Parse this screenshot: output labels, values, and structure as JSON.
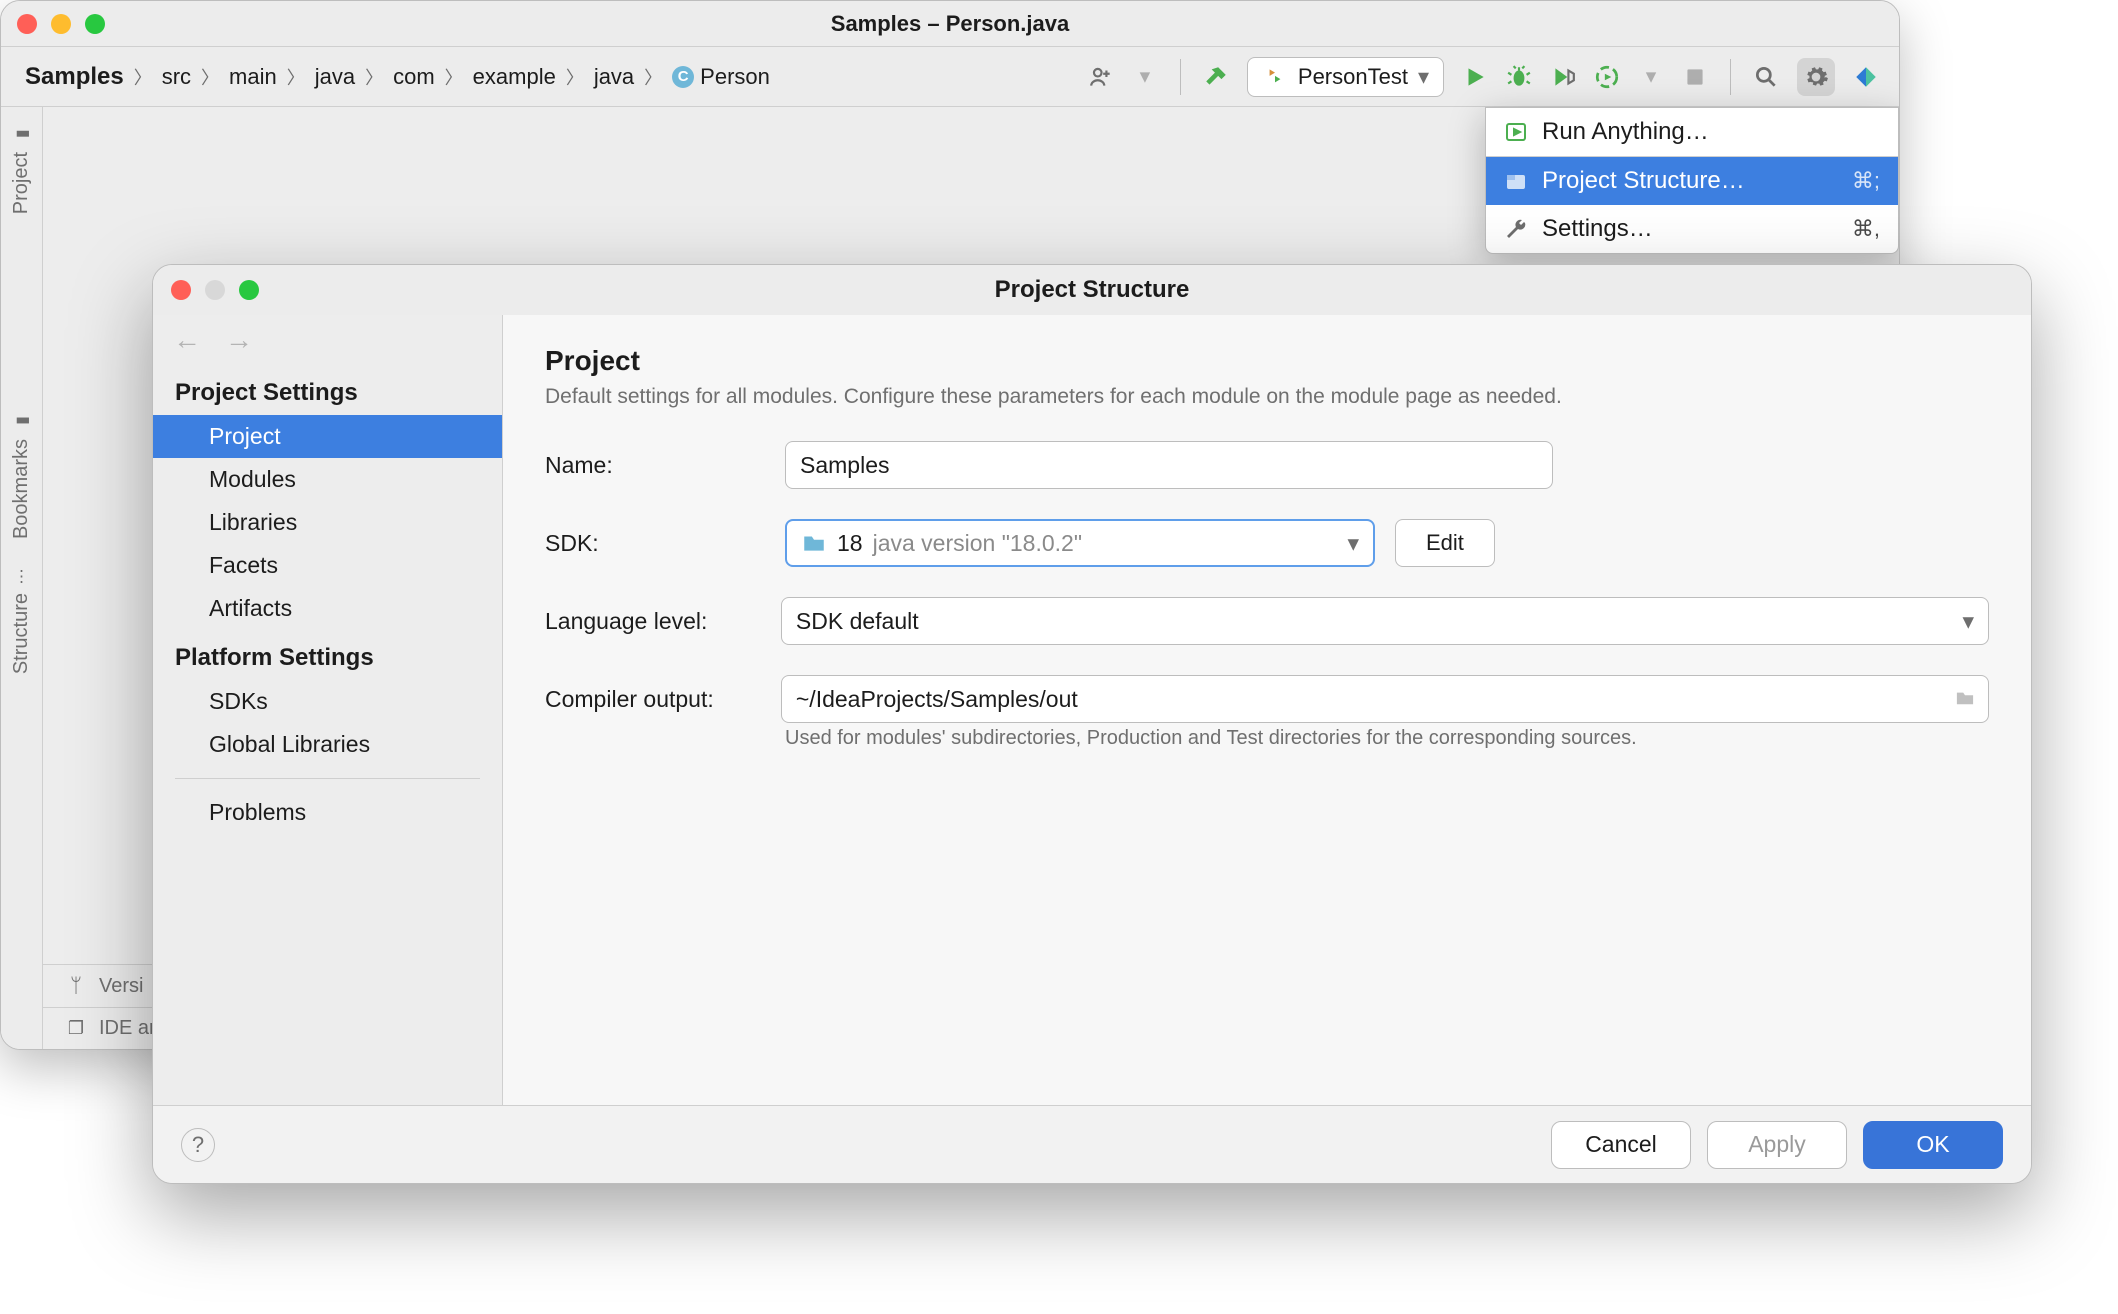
{
  "window": {
    "title": "Samples – Person.java"
  },
  "breadcrumbs": {
    "root": "Samples",
    "items": [
      "src",
      "main",
      "java",
      "com",
      "example",
      "java"
    ],
    "leaf": "Person",
    "leaf_icon": "C"
  },
  "toolbar": {
    "run_config_label": "PersonTest"
  },
  "left_tabs": {
    "project": "Project",
    "bookmarks": "Bookmarks",
    "structure": "Structure"
  },
  "statusbar": {
    "version": "Versi",
    "ide": "IDE ar"
  },
  "dropdown": {
    "run_anything": "Run Anything…",
    "project_structure": "Project Structure…",
    "project_structure_shortcut": "⌘;",
    "settings": "Settings…",
    "settings_shortcut": "⌘,"
  },
  "dialog": {
    "title": "Project Structure",
    "sidebar": {
      "section_project_settings": "Project Settings",
      "items_project_settings": [
        "Project",
        "Modules",
        "Libraries",
        "Facets",
        "Artifacts"
      ],
      "selected_index": 0,
      "section_platform_settings": "Platform Settings",
      "items_platform_settings": [
        "SDKs",
        "Global Libraries"
      ],
      "problems": "Problems"
    },
    "project": {
      "heading": "Project",
      "subtext": "Default settings for all modules. Configure these parameters for each module on the module page as needed.",
      "name_label": "Name:",
      "name_value": "Samples",
      "sdk_label": "SDK:",
      "sdk_value": "18",
      "sdk_version_text": "java version \"18.0.2\"",
      "edit_label": "Edit",
      "lang_label": "Language level:",
      "lang_value": "SDK default",
      "compiler_label": "Compiler output:",
      "compiler_value": "~/IdeaProjects/Samples/out",
      "compiler_hint": "Used for modules' subdirectories, Production and Test directories for the corresponding sources."
    },
    "footer": {
      "cancel": "Cancel",
      "apply": "Apply",
      "ok": "OK"
    }
  }
}
